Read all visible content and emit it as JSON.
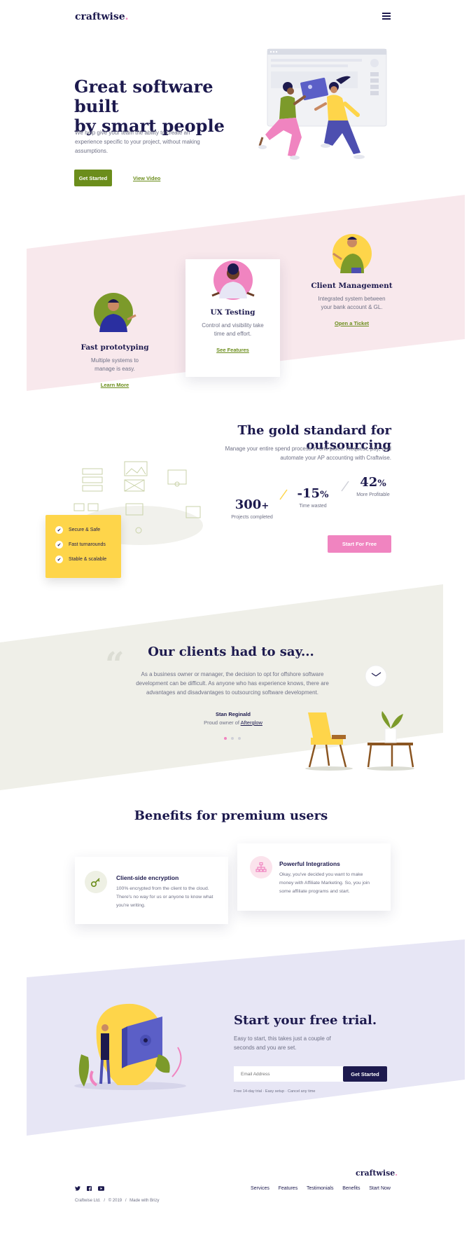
{
  "brand": {
    "name": "craftwise",
    "dot": "."
  },
  "hero": {
    "title_line1": "Great software built",
    "title_line2": "by smart people",
    "description": "We help give your team the ability to create an experience specific to your project, without making assumptions.",
    "primary_button": "Get Started",
    "secondary_link": "View Video"
  },
  "features": [
    {
      "title": "Fast prototyping",
      "text": "Multiple systems to manage is easy.",
      "link": "Learn More"
    },
    {
      "title": "UX Testing",
      "text": "Control and visibility take time and effort.",
      "link": "See Features"
    },
    {
      "title": "Client Management",
      "text": "Integrated system between your bank account & GL.",
      "link": "Open a Ticket"
    }
  ],
  "gold": {
    "title": "The gold standard for outsourcing",
    "description": "Manage your entire spend process in one place. Request, pay, and automate your AP accounting with Craftwise.",
    "stats": [
      {
        "value": "300",
        "suffix": "+",
        "label": "Projects completed"
      },
      {
        "value": "-15",
        "suffix": "%",
        "label": "Time wasted"
      },
      {
        "value": "42",
        "suffix": "%",
        "label": "More Profitable"
      }
    ],
    "checklist": [
      "Secure & Safe",
      "Fast turnarounds",
      "Stable & scalable"
    ],
    "button": "Start For Free"
  },
  "testimonial": {
    "title": "Our clients had to say...",
    "quote": "As a business owner or manager, the decision to opt for offshore software development can be difficult. As anyone who has experience knows, there are advantages and disadvantages to outsourcing software development.",
    "author": "Stan Reginald",
    "role_prefix": "Proud owner of ",
    "role_company": "Afterglow"
  },
  "benefits": {
    "title": "Benefits for premium users",
    "items": [
      {
        "title": "Client-side encryption",
        "text": "100% encrypted from the client to the cloud. There's no way for us or anyone to know what you're writing.",
        "icon": "key-icon"
      },
      {
        "title": "Powerful Integrations",
        "text": "Okay, you've decided you want to make money with Affiliate Marketing. So, you join some affiliate programs and start.",
        "icon": "network-icon"
      }
    ]
  },
  "trial": {
    "title": "Start your free trial.",
    "description": "Easy to start, this takes just a couple of seconds and you are set.",
    "email_placeholder": "Email Address",
    "button": "Get Started",
    "note": "Free 14-day trial · Easy setup · Cancel any time"
  },
  "footer": {
    "brand": "craftwise",
    "links": [
      "Services",
      "Features",
      "Testimonials",
      "Benefits",
      "Start Now"
    ],
    "copyright": [
      "Craftwise Ltd.",
      "© 2019",
      "Made with Brizy"
    ],
    "social": [
      "twitter-icon",
      "facebook-icon",
      "youtube-icon"
    ]
  },
  "colors": {
    "navy": "#1d1a4e",
    "olive": "#6b8d1b",
    "pink": "#f084c0",
    "yellow": "#fed54a",
    "blush": "#f8e8ec",
    "beige": "#efefe8",
    "lavender": "#e7e6f5"
  }
}
